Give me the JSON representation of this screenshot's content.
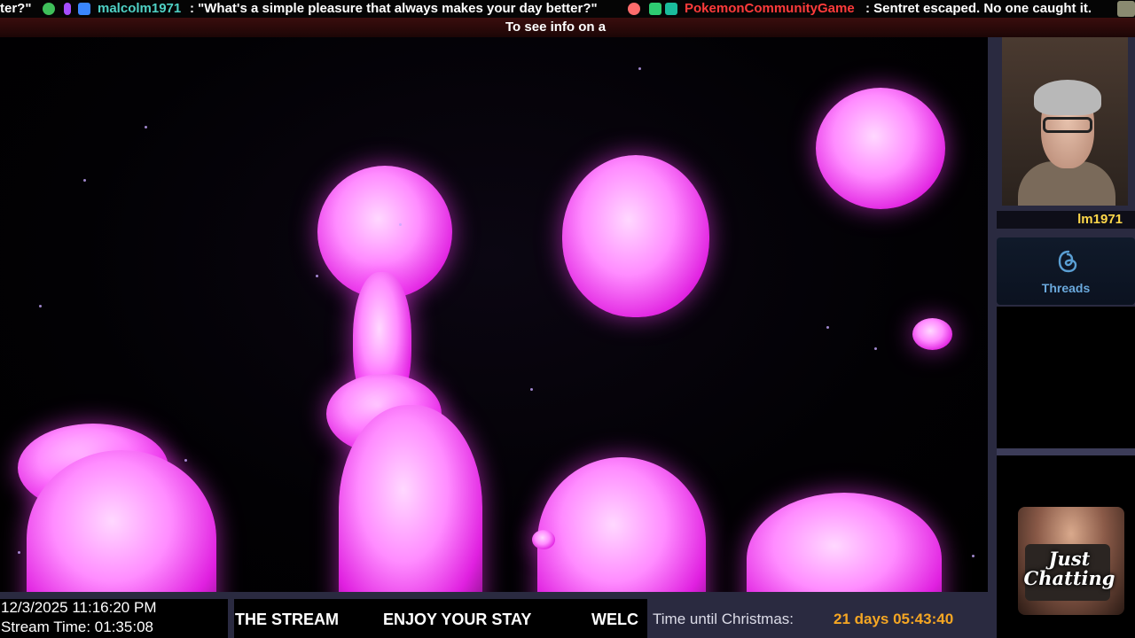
{
  "ticker": {
    "lead_fragment": "ter?\"",
    "user1_name": "malcolm1971",
    "user1_message": ": \"What's a simple pleasure that always makes your day better?\"",
    "user2_name": "PokemonCommunityGame",
    "user2_message": ": Sentret escaped. No one caught it."
  },
  "subbar": {
    "text": "To see info on a"
  },
  "webcam": {
    "name_label": "lm1971"
  },
  "threads": {
    "label": "Threads",
    "icon": "threads-icon"
  },
  "category": {
    "text": "Just Chatting"
  },
  "clock": {
    "datetime": "12/3/2025 11:16:20 PM",
    "stream_time": "Stream Time: 01:35:08"
  },
  "marquee": {
    "items": [
      "THE STREAM",
      "ENJOY YOUR STAY",
      "WELC"
    ]
  },
  "countdown": {
    "label": "Time until Christmas:",
    "value": "21 days 05:43:40"
  },
  "colors": {
    "accent_gold": "#f5a623",
    "lava_pink": "#ff66ff",
    "frame": "#2a2a40"
  }
}
